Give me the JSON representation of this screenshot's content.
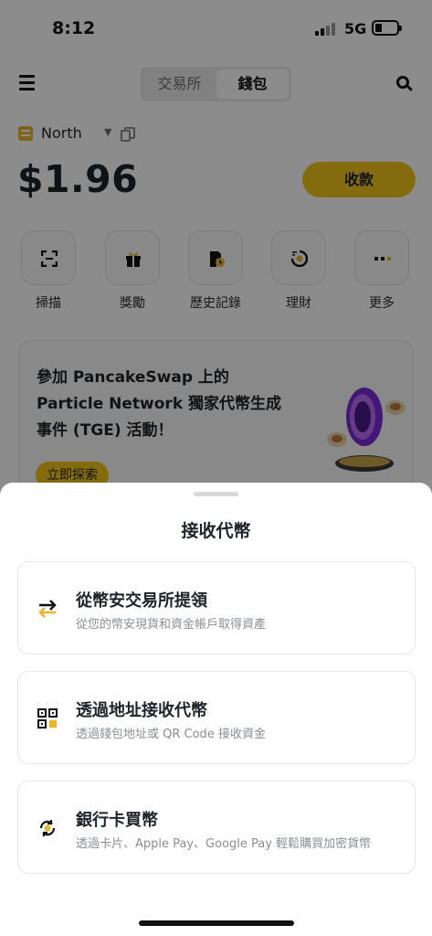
{
  "status_bar": {
    "time": "8:12",
    "network": "5G"
  },
  "header": {
    "tabs": [
      {
        "label": "交易所",
        "selected": false
      },
      {
        "label": "錢包",
        "selected": true
      }
    ]
  },
  "wallet": {
    "name": "North",
    "balance": "$1.96",
    "receive_label": "收款"
  },
  "actions": [
    {
      "label": "掃描",
      "icon": "scan-icon"
    },
    {
      "label": "獎勵",
      "icon": "gift-icon"
    },
    {
      "label": "歷史記錄",
      "icon": "history-icon"
    },
    {
      "label": "理財",
      "icon": "earn-icon"
    },
    {
      "label": "更多",
      "icon": "more-icon"
    }
  ],
  "promo": {
    "line1": "參加 PancakeSwap 上的",
    "line2": "Particle Network 獨家代幣生成",
    "line3": "事件 (TGE) 活動！",
    "button": "立即探索"
  },
  "sheet": {
    "title": "接收代幣",
    "options": [
      {
        "title": "從幣安交易所提領",
        "desc": "從您的幣安現貨和資金帳戶取得資產",
        "icon": "transfer-icon"
      },
      {
        "title": "透過地址接收代幣",
        "desc": "透過錢包地址或 QR Code 接收資金",
        "icon": "qr-code-icon"
      },
      {
        "title": "銀行卡買幣",
        "desc": "透過卡片、Apple Pay、Google Pay 輕鬆購買加密貨幣",
        "icon": "card-buy-icon"
      }
    ]
  },
  "colors": {
    "accent": "#f0c419",
    "text": "#1e2329",
    "muted": "#8a8f95"
  }
}
